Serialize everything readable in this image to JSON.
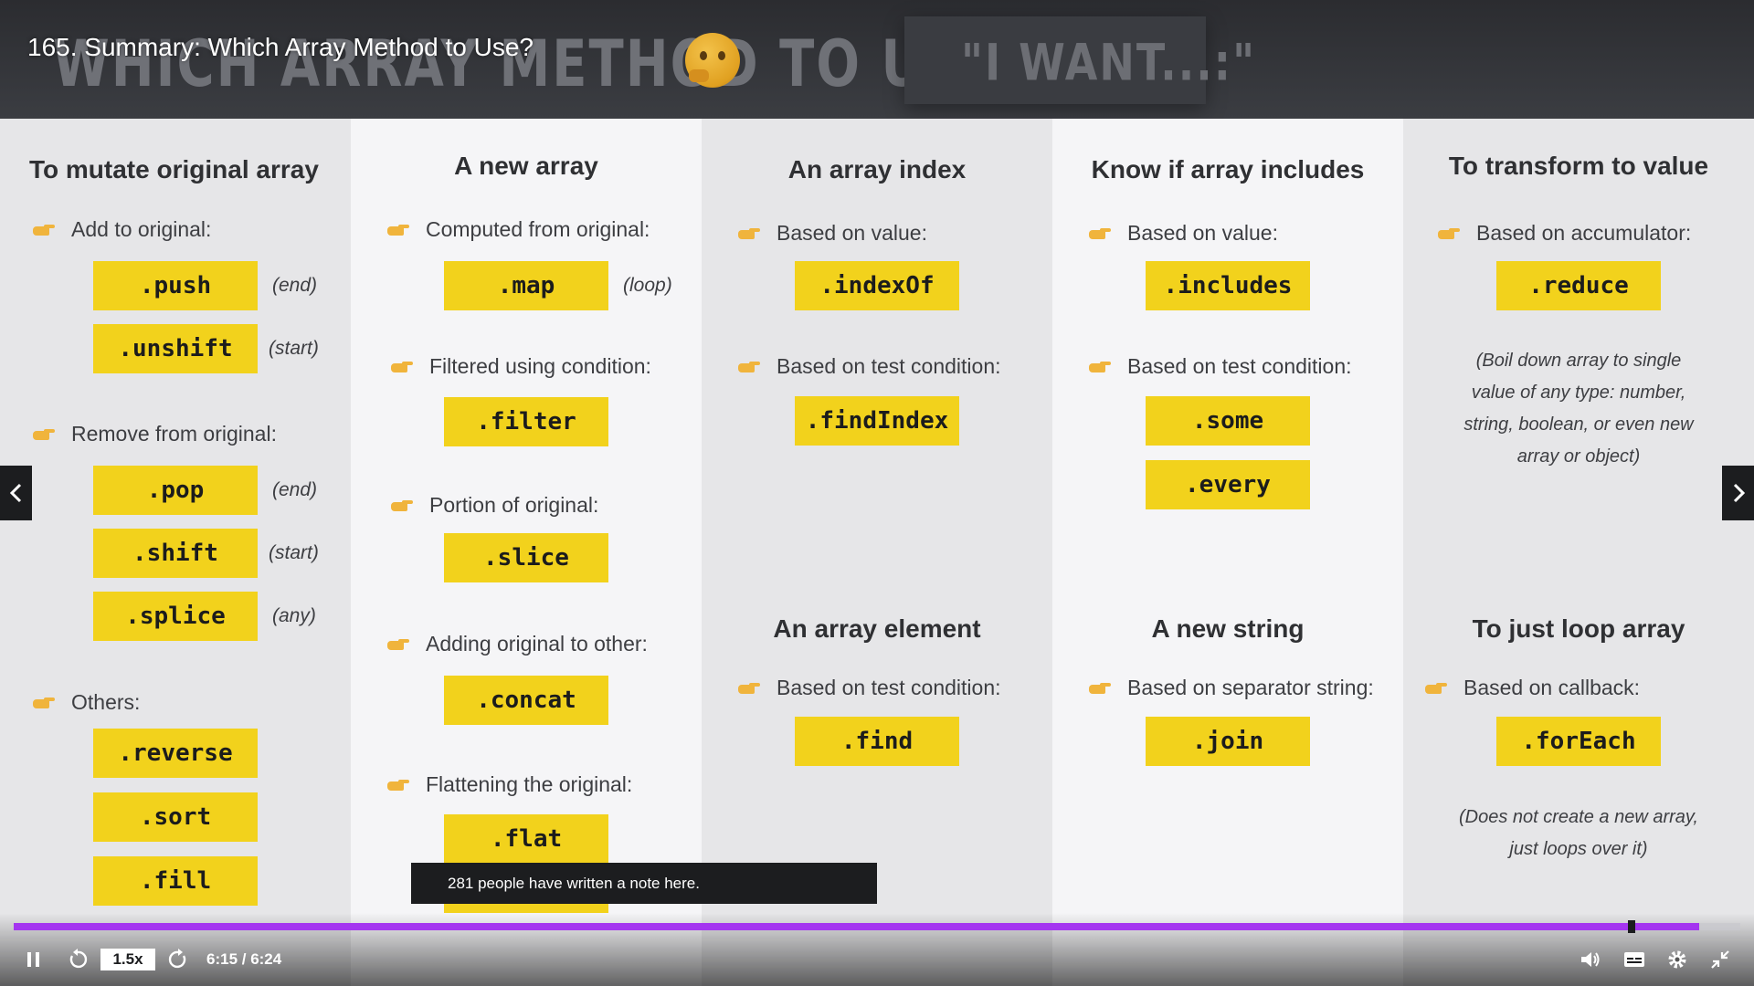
{
  "lecture": {
    "title": "165. Summary: Which Array Method to Use?"
  },
  "slide": {
    "heading": "WHICH ARRAY METHOD TO USE?",
    "i_want": "\"I WANT...:\"",
    "columns": [
      {
        "title": "To mutate original array",
        "groups": [
          {
            "label": "Add to original:",
            "methods": [
              {
                "name": ".push",
                "note": "(end)"
              },
              {
                "name": ".unshift",
                "note": "(start)"
              }
            ]
          },
          {
            "label": "Remove from original:",
            "methods": [
              {
                "name": ".pop",
                "note": "(end)"
              },
              {
                "name": ".shift",
                "note": "(start)"
              },
              {
                "name": ".splice",
                "note": "(any)"
              }
            ]
          },
          {
            "label": "Others:",
            "methods": [
              {
                "name": ".reverse"
              },
              {
                "name": ".sort"
              },
              {
                "name": ".fill"
              }
            ]
          }
        ]
      },
      {
        "title": "A new array",
        "groups": [
          {
            "label": "Computed from original:",
            "methods": [
              {
                "name": ".map",
                "note": "(loop)"
              }
            ]
          },
          {
            "label": "Filtered using condition:",
            "methods": [
              {
                "name": ".filter"
              }
            ]
          },
          {
            "label": "Portion of original:",
            "methods": [
              {
                "name": ".slice"
              }
            ]
          },
          {
            "label": "Adding original to other:",
            "methods": [
              {
                "name": ".concat"
              }
            ]
          },
          {
            "label": "Flattening the original:",
            "methods": [
              {
                "name": ".flat"
              },
              {
                "name": ".flatMap"
              }
            ]
          }
        ]
      },
      {
        "title": "An array index",
        "groups": [
          {
            "label": "Based on value:",
            "methods": [
              {
                "name": ".indexOf"
              }
            ]
          },
          {
            "label": "Based on test condition:",
            "methods": [
              {
                "name": ".findIndex"
              }
            ]
          }
        ],
        "title2": "An array element",
        "groups2": [
          {
            "label": "Based on test condition:",
            "methods": [
              {
                "name": ".find"
              }
            ]
          }
        ]
      },
      {
        "title": "Know if array includes",
        "groups": [
          {
            "label": "Based on value:",
            "methods": [
              {
                "name": ".includes"
              }
            ]
          },
          {
            "label": "Based on test condition:",
            "methods": [
              {
                "name": ".some"
              },
              {
                "name": ".every"
              }
            ]
          }
        ],
        "title2": "A new string",
        "groups2": [
          {
            "label": "Based on separator string:",
            "methods": [
              {
                "name": ".join"
              }
            ]
          }
        ]
      },
      {
        "title": "To transform to value",
        "groups": [
          {
            "label": "Based on accumulator:",
            "methods": [
              {
                "name": ".reduce"
              }
            ]
          }
        ],
        "para": [
          "(Boil down array to single",
          "value of any type: number,",
          "string, boolean, or even new",
          "array or object)"
        ],
        "title2": "To just loop array",
        "groups2": [
          {
            "label": "Based on callback:",
            "methods": [
              {
                "name": ".forEach"
              }
            ]
          }
        ],
        "para2": [
          "(Does not create a new array,",
          "just loops over it)"
        ]
      }
    ]
  },
  "note_tooltip": "281 people have written a note here.",
  "player": {
    "speed": "1.5x",
    "time": "6:15 / 6:24",
    "progress": 0.976,
    "accent": "#a435f0",
    "icons": [
      "pause-icon",
      "rewind-icon",
      "forward-icon",
      "volume-icon",
      "captions-icon",
      "settings-icon",
      "exit-fullscreen-icon",
      "chevron-left-icon",
      "chevron-right-icon"
    ]
  }
}
